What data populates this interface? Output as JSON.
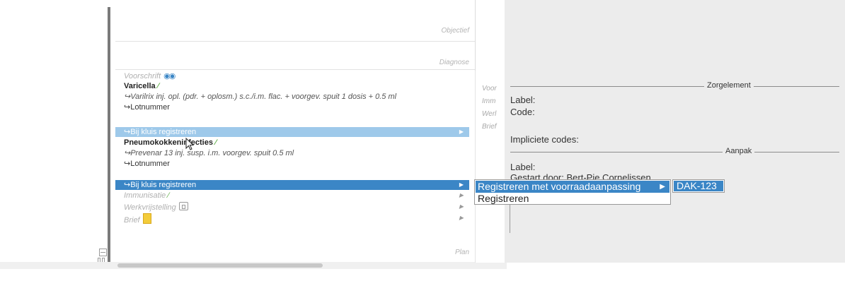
{
  "sections": {
    "objectief": "Objectief",
    "diagnose": "Diagnose",
    "plan": "Plan"
  },
  "rows": {
    "voorschrift": "Voorschrift",
    "varicella": "Varicella",
    "varilrix": "↪Varilrix inj. opl. (pdr. + oplosm.) s.c./i.m. flac. + voorgev. spuit 1 dosis + 0.5 ml",
    "lotnummer1": "↪Lotnummer",
    "bij_kluis1": "↪Bij kluis registreren",
    "pneumokokken": "Pneumokokkeninfecties",
    "prevenar": "↪Prevenar 13 inj. susp. i.m. voorgev. spuit 0.5 ml",
    "lotnummer2": "↪Lotnummer",
    "bij_kluis2": "↪Bij kluis registreren",
    "immunisatie": "Immunisatie",
    "werkvrijstelling": "Werkvrijstelling",
    "brief": "Brief"
  },
  "icons": {
    "arrow": "▶",
    "leaf": "∕",
    "binoculars": "◉◉"
  },
  "mid_strip": [
    "Voor",
    "Imm",
    "Werl",
    "Brief"
  ],
  "right_panel": {
    "zorgelement_title": "Zorgelement",
    "aanpak_title": "Aanpak",
    "label1": "Label:",
    "code": "Code:",
    "impliciete": "Impliciete codes:",
    "label2": "Label:",
    "gestart": "Gestart door: Bert-Pie Cornelissen"
  },
  "context_menu": {
    "item1": "Registreren met voorraadaanpassing",
    "item2": "Registreren",
    "submenu_item": "DAK-123"
  },
  "colors": {
    "selection_dark": "#3b86c6",
    "selection_light": "#9ec9ea",
    "leaf_green": "#5fae48",
    "right_panel_bg": "#ececec"
  }
}
